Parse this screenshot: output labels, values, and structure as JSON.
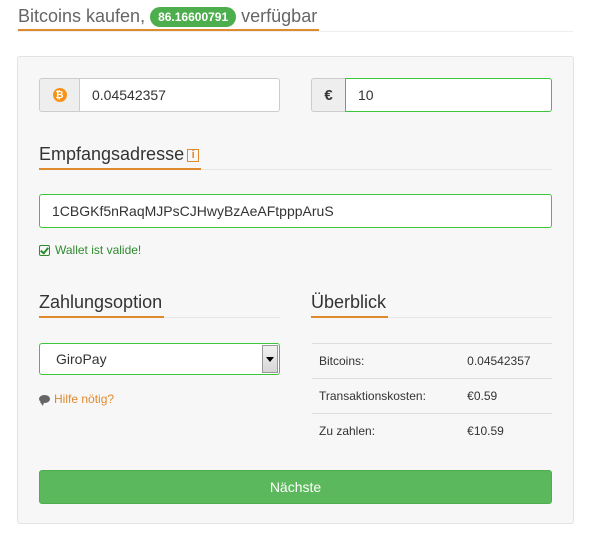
{
  "header": {
    "title_prefix": "Bitcoins kaufen,",
    "available_amount": "86.16600791",
    "title_suffix": "verfügbar"
  },
  "amount": {
    "btc_icon": "bitcoin-icon",
    "btc_value": "0.04542357",
    "eur_symbol": "€",
    "eur_value": "10"
  },
  "address": {
    "heading": "Empfangsadresse",
    "info_icon": "i",
    "value": "1CBGKf5nRaqMJPsCJHwyBzAeAFtpppAruS",
    "valid_text": "Wallet ist valide!"
  },
  "payment": {
    "heading": "Zahlungsoption",
    "selected": "GiroPay",
    "help_text": "Hilfe nötig?"
  },
  "overview": {
    "heading": "Überblick",
    "rows": [
      {
        "label": "Bitcoins:",
        "value": "0.04542357"
      },
      {
        "label": "Transaktionskosten:",
        "value": "€0.59"
      },
      {
        "label": "Zu zahlen:",
        "value": "€10.59"
      }
    ]
  },
  "actions": {
    "next_label": "Nächste"
  },
  "colors": {
    "accent": "#e08a2e",
    "success": "#5cb85c",
    "valid_border": "#3cc63c",
    "bitcoin": "#f7931a"
  }
}
